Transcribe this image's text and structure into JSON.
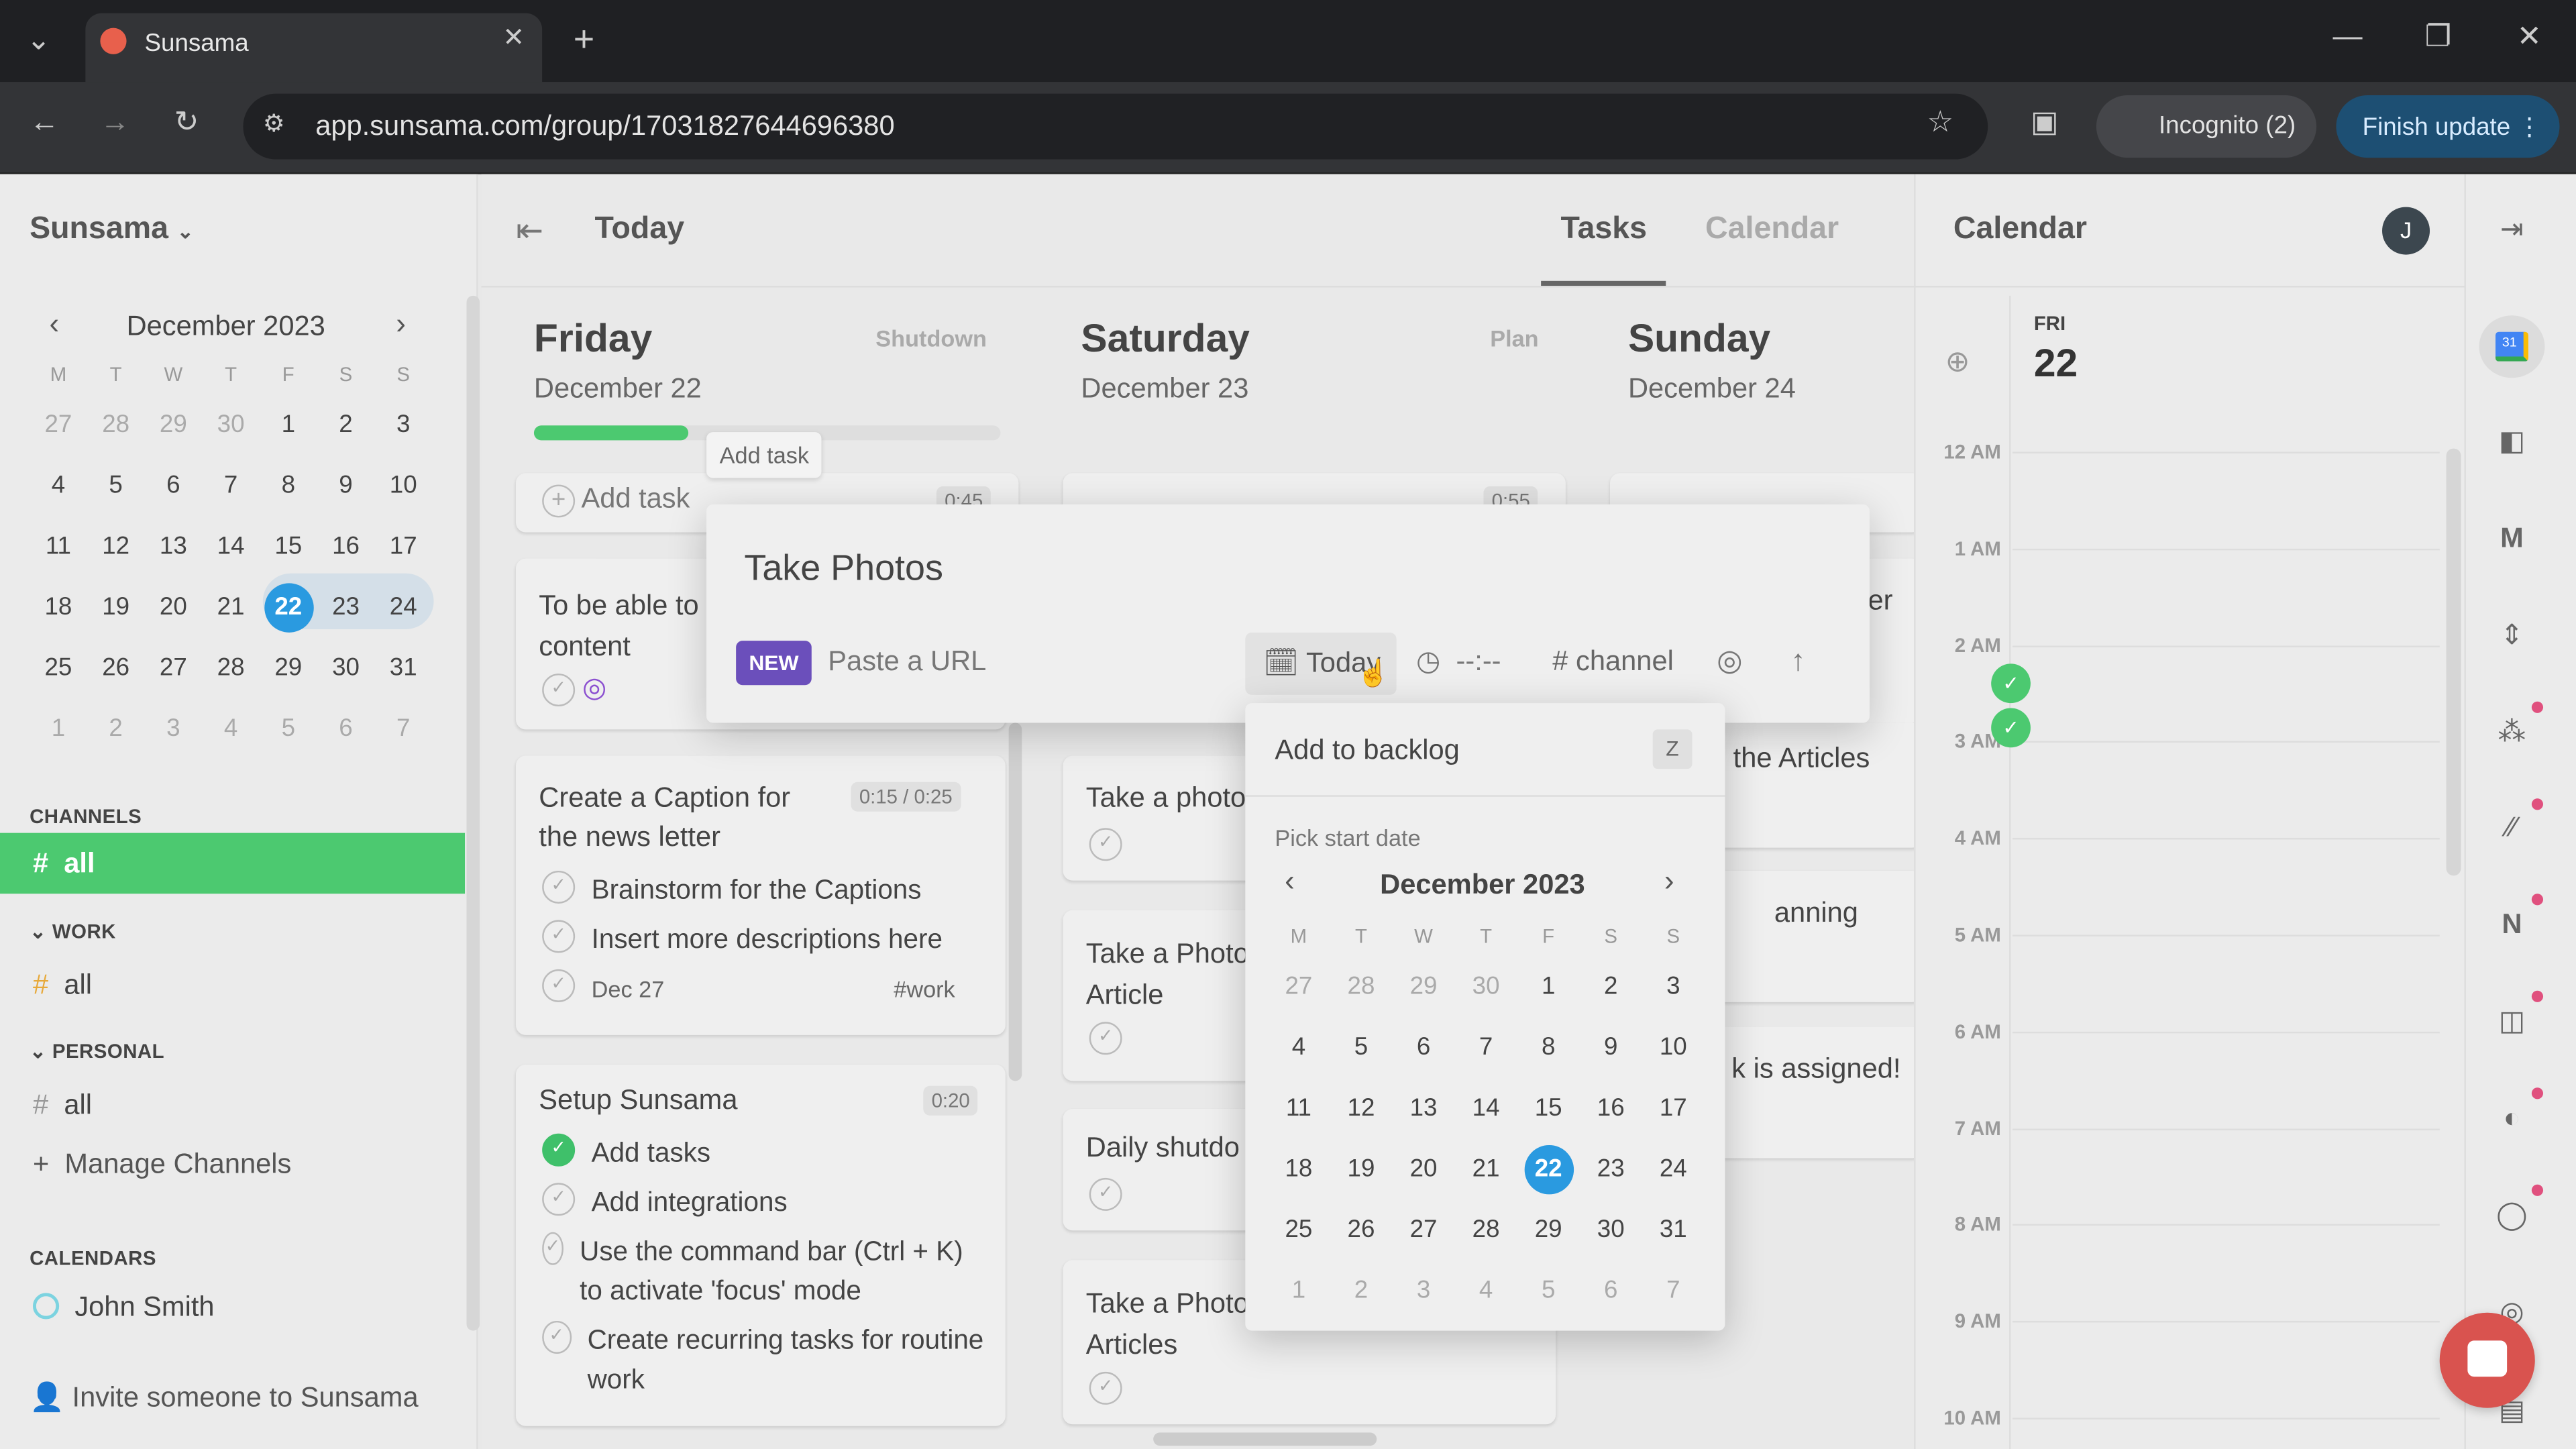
{
  "browser": {
    "tab_title": "Sunsama",
    "url": "app.sunsama.com/group/17031827644696380",
    "profile": "Incognito (2)",
    "update_button": "Finish update"
  },
  "sidebar": {
    "workspace": "Sunsama",
    "mini_calendar": {
      "month": "December 2023",
      "weekdays": [
        "M",
        "T",
        "W",
        "T",
        "F",
        "S",
        "S"
      ],
      "weeks": [
        [
          "27",
          "28",
          "29",
          "30",
          "1",
          "2",
          "3"
        ],
        [
          "4",
          "5",
          "6",
          "7",
          "8",
          "9",
          "10"
        ],
        [
          "11",
          "12",
          "13",
          "14",
          "15",
          "16",
          "17"
        ],
        [
          "18",
          "19",
          "20",
          "21",
          "22",
          "23",
          "24"
        ],
        [
          "25",
          "26",
          "27",
          "28",
          "29",
          "30",
          "31"
        ],
        [
          "1",
          "2",
          "3",
          "4",
          "5",
          "6",
          "7"
        ]
      ],
      "selected": "22"
    },
    "channels_heading": "CHANNELS",
    "channels_all": "all",
    "work_heading": "WORK",
    "work_all": "all",
    "personal_heading": "PERSONAL",
    "personal_all": "all",
    "manage_channels": "Manage Channels",
    "calendars_heading": "CALENDARS",
    "calendar_user": "John Smith",
    "invite": "Invite someone to Sunsama"
  },
  "header": {
    "title": "Today",
    "tabs": [
      "Tasks",
      "Calendar"
    ],
    "active_tab": "Tasks"
  },
  "progress": {
    "friday_complete": 0.33
  },
  "days": [
    {
      "name": "Friday",
      "date": "December 22",
      "action": "Shutdown",
      "add_task": "Add task",
      "total": "0:45",
      "cards": [
        {
          "title_a": "To be able to",
          "title_b": "content"
        },
        {
          "title": "Create a Caption for the news letter",
          "time": "0:15 / 0:25",
          "subtasks": [
            "Brainstorm for the Captions",
            "Insert more descriptions here"
          ],
          "due": "Dec 27",
          "channel": "#work"
        },
        {
          "title": "Setup Sunsama",
          "time": "0:20",
          "subtasks": [
            "Add tasks",
            "Add integrations",
            "Use the command bar (Ctrl + K) to activate 'focus' mode",
            "Create recurring tasks for routine work"
          ]
        }
      ]
    },
    {
      "name": "Saturday",
      "date": "December 23",
      "action": "Plan",
      "total": "0:55",
      "cards": [
        "Take a photo",
        "Take a Photo",
        "Article",
        "Daily shutdo",
        "Take a Photo",
        "Articles"
      ]
    },
    {
      "name": "Sunday",
      "date": "December 24",
      "cards": [
        "er",
        "the Articles",
        "anning",
        "k is assigned!"
      ]
    }
  ],
  "tooltip": "Add task",
  "modal": {
    "title": "Take Photos",
    "badge": "NEW",
    "url_placeholder": "Paste a URL",
    "date": "Today",
    "time": "--:--",
    "channel": "# channel"
  },
  "dropdown": {
    "backlog": "Add to backlog",
    "shortcut": "Z",
    "pick": "Pick start date",
    "month": "December 2023",
    "selected": "22"
  },
  "calendar_panel": {
    "title": "Calendar",
    "avatar": "J",
    "day": "FRI",
    "date": "22",
    "hours": [
      "12 AM",
      "1 AM",
      "2 AM",
      "3 AM",
      "4 AM",
      "5 AM",
      "6 AM",
      "7 AM",
      "8 AM",
      "9 AM",
      "10 AM"
    ]
  },
  "colors": {
    "accent_green": "#4cc970",
    "selected_blue": "#2a9ae0",
    "badge_purple": "#6b4fbb",
    "chat_red": "#d9534f"
  }
}
